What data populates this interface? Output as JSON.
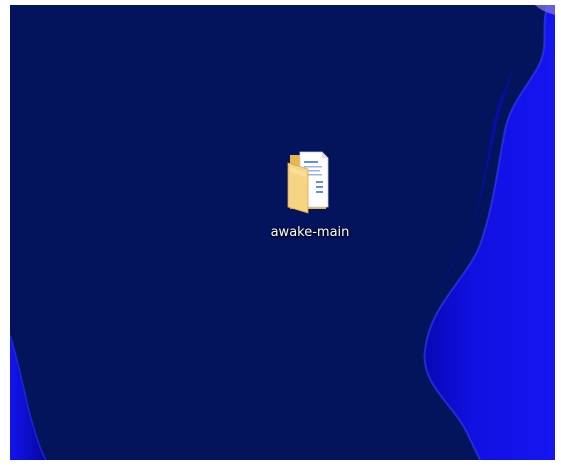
{
  "desktop": {
    "colors": {
      "background": "#03145c",
      "wave_bright": "#1414f0",
      "wave_mid": "#0a0ad2",
      "wave_dark": "#0707a8",
      "wave_edge": "#4a55ff"
    },
    "icons": [
      {
        "label": "awake-main",
        "icon": "folder-icon",
        "icon_colors": {
          "folder": "#f5d483",
          "folder_dark": "#e0b04a",
          "paper": "#ffffff",
          "paper_lines": "#6a8fd0"
        }
      }
    ]
  }
}
